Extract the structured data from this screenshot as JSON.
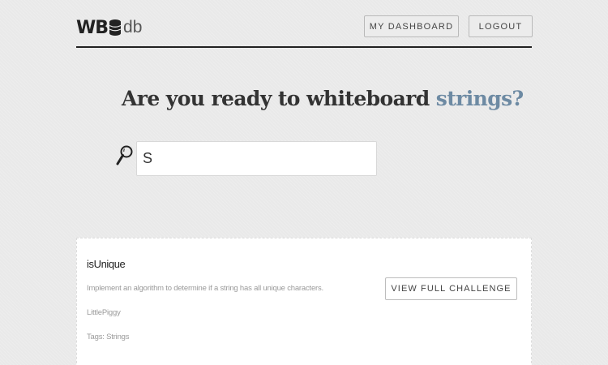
{
  "header": {
    "logo_prefix": "WB",
    "logo_icon": "database-icon",
    "logo_suffix": "db",
    "dashboard_label": "MY DASHBOARD",
    "logout_label": "LOGOUT"
  },
  "hero": {
    "headline_prefix": "Are you ready to whiteboard ",
    "headline_topic": "strings?",
    "topic_color": "#6d8aa3"
  },
  "search": {
    "icon": "search-icon",
    "value": "S"
  },
  "results": [
    {
      "title": "isUnique",
      "description": "Implement an algorithm to determine if a string has all unique characters.",
      "author": "LittlePiggy",
      "tags": "Tags: Strings",
      "action_label": "VIEW FULL CHALLENGE"
    }
  ]
}
